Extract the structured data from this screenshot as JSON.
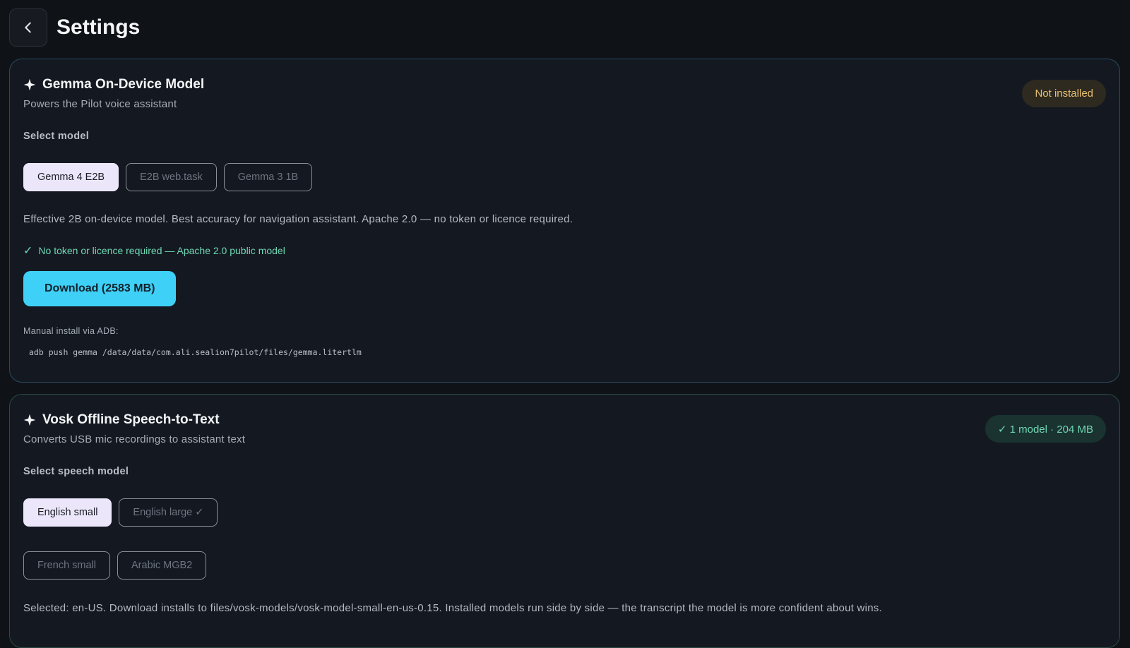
{
  "header": {
    "title": "Settings"
  },
  "gemma": {
    "title": "Gemma On-Device Model",
    "subtitle": "Powers the Pilot voice assistant",
    "badge": "Not installed",
    "select_label": "Select model",
    "models": [
      {
        "label": "Gemma 4 E2B",
        "selected": true
      },
      {
        "label": "E2B web.task",
        "selected": false
      },
      {
        "label": "Gemma 3 1B",
        "selected": false
      }
    ],
    "description": "Effective 2B on-device model. Best accuracy for navigation assistant. Apache 2.0 — no token or licence required.",
    "license_note": "No token or licence required — Apache 2.0 public model",
    "download_label": "Download (2583 MB)",
    "manual_label": "Manual install via ADB:",
    "adb_command": "adb push gemma /data/data/com.ali.sealion7pilot/files/gemma.litertlm"
  },
  "vosk": {
    "title": "Vosk Offline Speech-to-Text",
    "subtitle": "Converts USB mic recordings to assistant text",
    "badge": "✓ 1 model · 204 MB",
    "select_label": "Select speech model",
    "models_row1": [
      {
        "label": "English small",
        "selected": true
      },
      {
        "label": "English large ✓",
        "selected": false
      }
    ],
    "models_row2": [
      {
        "label": "French small",
        "selected": false
      },
      {
        "label": "Arabic MGB2",
        "selected": false
      }
    ],
    "description": "Selected: en-US. Download installs to files/vosk-models/vosk-model-small-en-us-0.15. Installed models run side by side — the transcript the model is more confident about wins."
  },
  "colors": {
    "accent": "#3fd0f7",
    "success": "#6fd6b3",
    "warning": "#e8c070",
    "background": "#0f1217"
  }
}
